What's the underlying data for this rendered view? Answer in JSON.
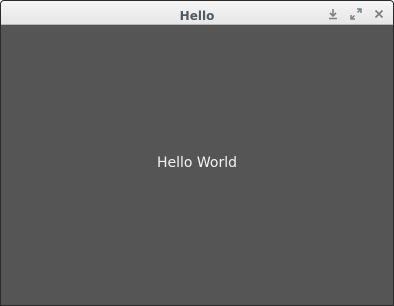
{
  "window": {
    "title": "Hello"
  },
  "titlebar": {
    "buttons": [
      {
        "icon": "download-icon"
      },
      {
        "icon": "maximize-icon"
      },
      {
        "icon": "close-icon"
      }
    ]
  },
  "content": {
    "text": "Hello World"
  },
  "colors": {
    "titlebar_bg": "#ececec",
    "title_text": "#4f5b62",
    "content_bg": "#555555",
    "content_text": "#f2f2f2"
  }
}
